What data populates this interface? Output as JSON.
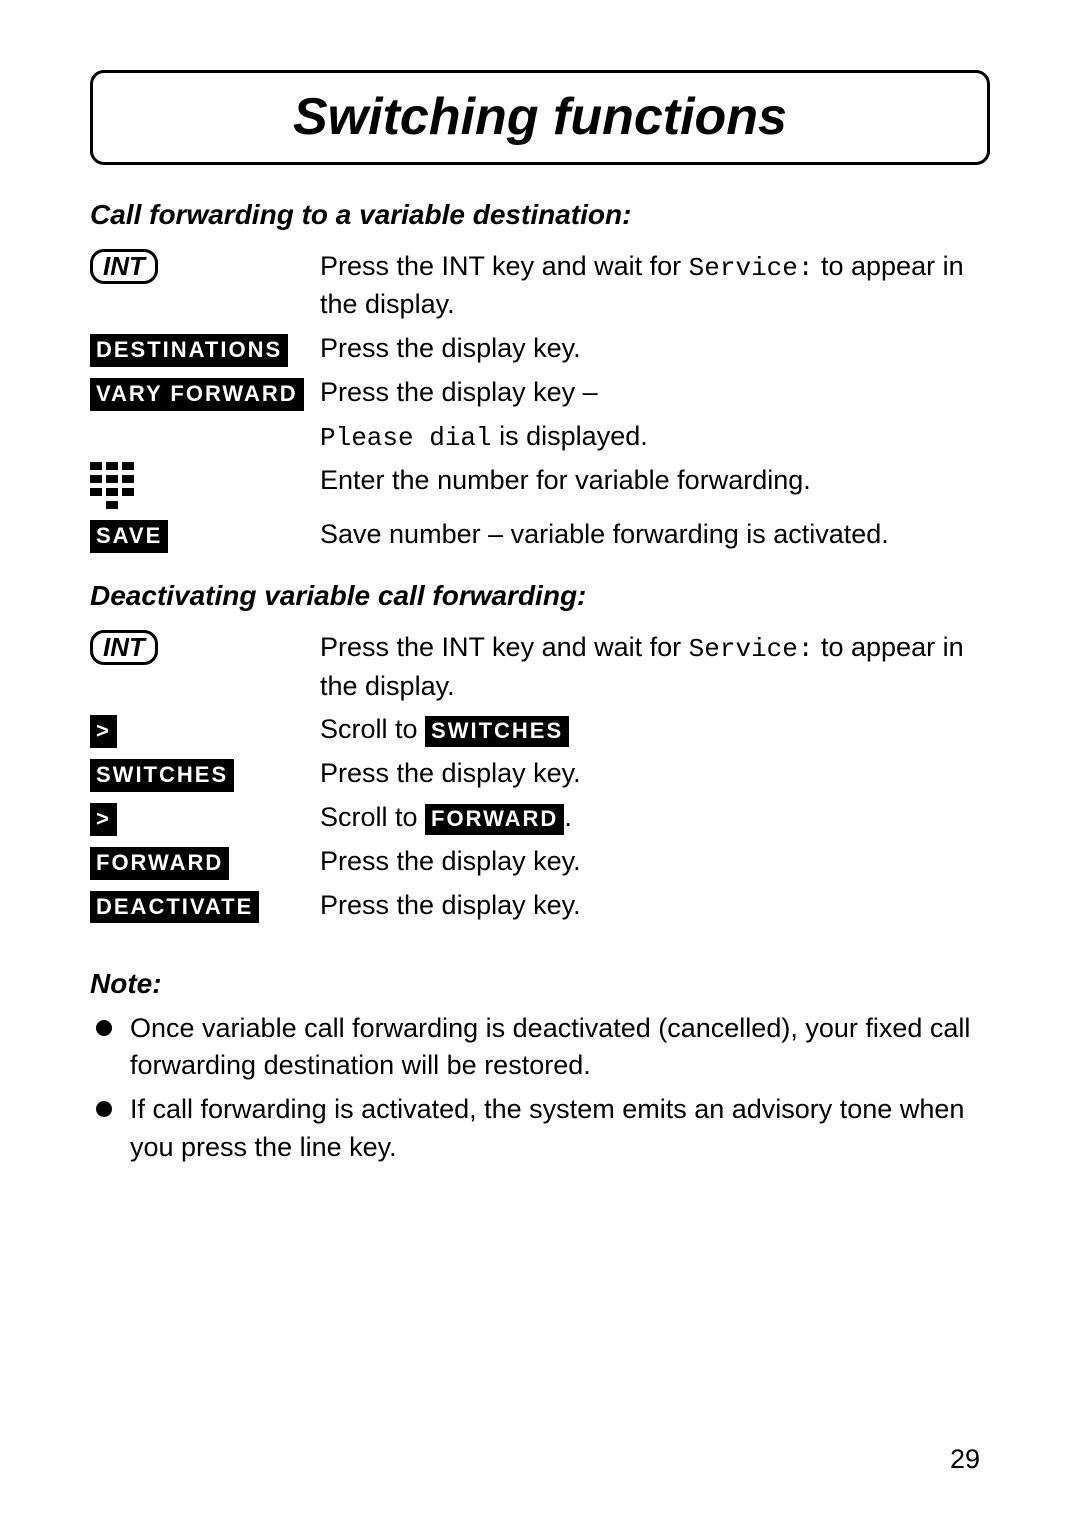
{
  "page_number": "29",
  "title": "Switching functions",
  "sections": [
    {
      "heading": "Call forwarding to a variable destination:",
      "steps": [
        {
          "key": {
            "kind": "int",
            "label": "INT"
          },
          "text_parts": [
            {
              "t": "Press the INT key and wait for "
            },
            {
              "t": "Service:",
              "mono": true
            },
            {
              "t": " to appear in the display."
            }
          ]
        },
        {
          "key": {
            "kind": "dk",
            "label": "DESTINATIONS"
          },
          "text_parts": [
            {
              "t": "Press the display key."
            }
          ]
        },
        {
          "key": {
            "kind": "dk",
            "label": "VARY FORWARD"
          },
          "text_parts": [
            {
              "t": "Press the display key –"
            }
          ]
        },
        {
          "key": {
            "kind": "none"
          },
          "text_parts": [
            {
              "t": "Please dial",
              "mono": true
            },
            {
              "t": " is displayed."
            }
          ]
        },
        {
          "key": {
            "kind": "keypad"
          },
          "text_parts": [
            {
              "t": "Enter the number for variable forwarding."
            }
          ]
        },
        {
          "key": {
            "kind": "dk",
            "label": "SAVE"
          },
          "text_parts": [
            {
              "t": "Save number – variable forwarding is activated."
            }
          ]
        }
      ]
    },
    {
      "heading": "Deactivating variable call forwarding:",
      "steps": [
        {
          "key": {
            "kind": "int",
            "label": "INT"
          },
          "text_parts": [
            {
              "t": "Press the INT key and wait for "
            },
            {
              "t": "Service:",
              "mono": true
            },
            {
              "t": " to appear in the display."
            }
          ]
        },
        {
          "key": {
            "kind": "dk",
            "label": ">"
          },
          "text_parts": [
            {
              "t": "Scroll to "
            },
            {
              "t": "SWITCHES",
              "dk": true
            }
          ]
        },
        {
          "key": {
            "kind": "dk",
            "label": "SWITCHES"
          },
          "text_parts": [
            {
              "t": "Press the display key."
            }
          ]
        },
        {
          "key": {
            "kind": "dk",
            "label": ">"
          },
          "text_parts": [
            {
              "t": "Scroll to "
            },
            {
              "t": "FORWARD",
              "dk": true
            },
            {
              "t": "."
            }
          ]
        },
        {
          "key": {
            "kind": "dk",
            "label": "FORWARD"
          },
          "text_parts": [
            {
              "t": "Press the display key."
            }
          ]
        },
        {
          "key": {
            "kind": "dk",
            "label": "DEACTIVATE"
          },
          "text_parts": [
            {
              "t": "Press the display key."
            }
          ]
        }
      ]
    }
  ],
  "note": {
    "heading": "Note:",
    "items": [
      "Once variable call forwarding is deactivated (cancelled), your fixed call forwarding destination will be restored.",
      "If call forwarding is activated, the system emits an advisory tone when you press the line key."
    ]
  }
}
